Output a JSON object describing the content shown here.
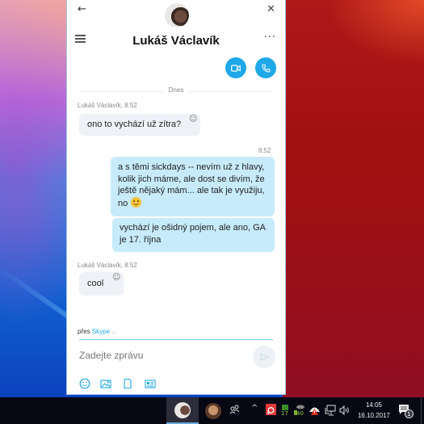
{
  "window": {
    "contact_name": "Lukáš Václavík",
    "icons": {
      "back": "←",
      "close": "✕",
      "more": "···"
    }
  },
  "conversation": {
    "day_separator": "Dnes",
    "messages": [
      {
        "direction": "incoming",
        "sender_meta": "Lukáš Václavík, 8:52",
        "text": "ono to vychází už zítra?"
      },
      {
        "direction": "outgoing",
        "time": "8:52",
        "text": "a s těmi sickdays -- nevím už z hlavy, kolik jich máme, ale dost se divím, že ještě nějaký mám... ale tak je využiju, no",
        "emoji": "smile"
      },
      {
        "direction": "outgoing",
        "text": "vychází je ošidný pojem, ale ano, GA je 17. října"
      },
      {
        "direction": "incoming",
        "sender_meta": "Lukáš Václavík, 8:52",
        "text": "cool"
      }
    ]
  },
  "composer": {
    "via_label": "přes",
    "via_service": "Skype",
    "via_chevron": "⌵",
    "placeholder": "Zadejte zprávu",
    "value": "",
    "tools": [
      "emoji",
      "media",
      "file",
      "contact-card"
    ]
  },
  "taskbar": {
    "tray_overflow": "^",
    "clock_time": "14:05",
    "clock_date": "16.10.2017",
    "notification_count": "1",
    "tray_badges": {
      "green_app": "17",
      "gray_app": "40"
    }
  },
  "colors": {
    "accent": "#1ea8e8",
    "outgoing_bubble": "#c7ebfa",
    "incoming_bubble": "#eef1f5"
  }
}
